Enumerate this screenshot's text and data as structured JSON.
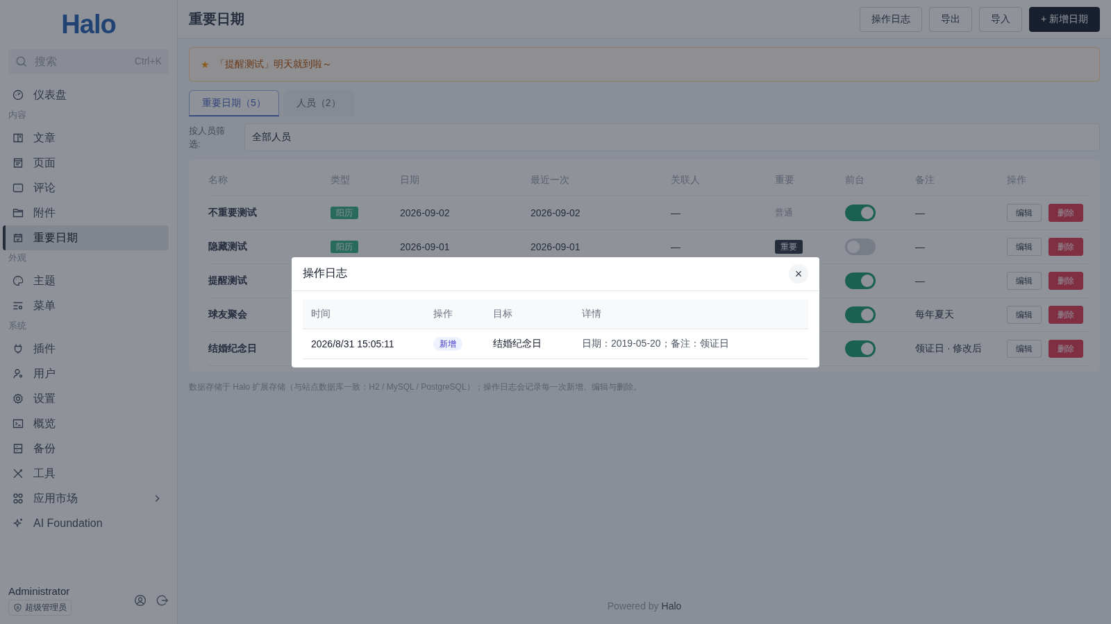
{
  "sidebar": {
    "logo": "Halo",
    "search": {
      "placeholder": "搜索",
      "shortcut": "Ctrl+K"
    },
    "top_items": [
      {
        "label": "仪表盘",
        "selected": false
      }
    ],
    "groups": [
      {
        "title": "内容",
        "items": [
          {
            "label": "文章",
            "selected": false
          },
          {
            "label": "页面",
            "selected": false
          },
          {
            "label": "评论",
            "selected": false
          },
          {
            "label": "附件",
            "selected": false
          },
          {
            "label": "重要日期",
            "selected": true
          }
        ]
      },
      {
        "title": "外观",
        "items": [
          {
            "label": "主题",
            "selected": false
          },
          {
            "label": "菜单",
            "selected": false
          }
        ]
      },
      {
        "title": "系统",
        "items": [
          {
            "label": "插件",
            "selected": false
          },
          {
            "label": "用户",
            "selected": false
          },
          {
            "label": "设置",
            "selected": false
          },
          {
            "label": "概览",
            "selected": false
          },
          {
            "label": "备份",
            "selected": false
          },
          {
            "label": "工具",
            "selected": false
          },
          {
            "label": "应用市场",
            "selected": false,
            "has_submenu": true
          },
          {
            "label": "AI Foundation",
            "selected": false
          }
        ]
      }
    ],
    "user": {
      "name": "Administrator",
      "role": "超级管理员"
    }
  },
  "header": {
    "title": "重要日期",
    "buttons": [
      {
        "label": "操作日志",
        "kind": "plain"
      },
      {
        "label": "导出",
        "kind": "plain"
      },
      {
        "label": "导入",
        "kind": "plain"
      },
      {
        "label": "+ 新增日期",
        "kind": "primary"
      }
    ]
  },
  "alert": {
    "icon": "★",
    "text": "「提醒测试」明天就到啦～"
  },
  "tabs": [
    {
      "label": "重要日期（5）",
      "selected": true
    },
    {
      "label": "人员（2）",
      "selected": false
    }
  ],
  "filter": {
    "label": "按人员筛选:",
    "value": "全部人员"
  },
  "table": {
    "columns": [
      "名称",
      "类型",
      "日期",
      "最近一次",
      "关联人",
      "重要",
      "前台",
      "备注",
      "操作"
    ],
    "rows": [
      {
        "name": "不重要测试",
        "type": "阳历",
        "date": "2026-09-02",
        "recent": "2026-09-02",
        "linked": "—",
        "important": false,
        "importance": "普通",
        "shown": true,
        "remark": "—",
        "actions": [
          "编辑",
          "删除"
        ]
      },
      {
        "name": "隐藏测试",
        "type": "阳历",
        "date": "2026-09-01",
        "recent": "2026-09-01",
        "linked": "—",
        "important": true,
        "importance": "重要",
        "shown": false,
        "remark": "—",
        "actions": [
          "编辑",
          "删除"
        ]
      },
      {
        "name": "提醒测试",
        "shown": true,
        "remark": "—",
        "actions": [
          "编辑",
          "删除"
        ]
      },
      {
        "name": "球友聚会",
        "shown": true,
        "remark": "每年夏天",
        "actions": [
          "编辑",
          "删除"
        ]
      },
      {
        "name": "结婚纪念日",
        "shown": true,
        "remark": "领证日 · 修改后",
        "actions": [
          "编辑",
          "删除"
        ]
      }
    ]
  },
  "note": "数据存储于 Halo 扩展存储（与站点数据库一致：H2 / MySQL / PostgreSQL）；操作日志会记录每一次新增、编辑与删除。",
  "footer": {
    "text": "Powered by",
    "brand": "Halo"
  },
  "dialog": {
    "title": "操作日志",
    "close": "×",
    "columns": [
      "时间",
      "操作",
      "目标",
      "详情"
    ],
    "rows": [
      {
        "time": "2026/8/31 15:05:11",
        "action": "新增",
        "kind": "add",
        "target": "结婚纪念日",
        "detail": "日期：2019-05-20；备注：领证日"
      }
    ]
  }
}
